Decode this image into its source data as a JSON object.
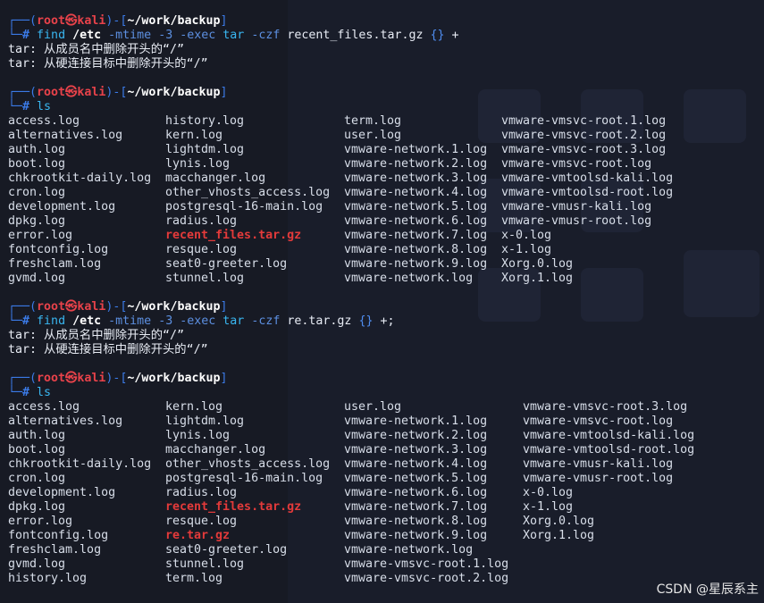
{
  "prompt": {
    "user_host": "root㉿kali",
    "cwd": "~/work/backup",
    "edge_top_left": "┌──(",
    "edge_mid": ")-[",
    "edge_end": "]",
    "edge_bottom": "└─",
    "hash": "#"
  },
  "commands": [
    {
      "tokens": [
        "find",
        "/etc",
        "-mtime",
        "-3",
        "-exec",
        "tar",
        "-czf",
        "recent_files.tar.gz",
        "{}",
        "+"
      ],
      "output": [
        "tar: 从成员名中删除开头的“/”",
        "tar: 从硬连接目标中删除开头的“/”"
      ]
    },
    {
      "tokens": [
        "ls"
      ],
      "columns": [
        [
          "access.log",
          "alternatives.log",
          "auth.log",
          "boot.log",
          "chkrootkit-daily.log",
          "cron.log",
          "development.log",
          "dpkg.log",
          "error.log",
          "fontconfig.log",
          "freshclam.log",
          "gvmd.log"
        ],
        [
          "history.log",
          "kern.log",
          "lightdm.log",
          "lynis.log",
          "macchanger.log",
          "other_vhosts_access.log",
          "postgresql-16-main.log",
          "radius.log",
          "recent_files.tar.gz",
          "resque.log",
          "seat0-greeter.log",
          "stunnel.log"
        ],
        [
          "term.log",
          "user.log",
          "vmware-network.1.log",
          "vmware-network.2.log",
          "vmware-network.3.log",
          "vmware-network.4.log",
          "vmware-network.5.log",
          "vmware-network.6.log",
          "vmware-network.7.log",
          "vmware-network.8.log",
          "vmware-network.9.log",
          "vmware-network.log"
        ],
        [
          "vmware-vmsvc-root.1.log",
          "vmware-vmsvc-root.2.log",
          "vmware-vmsvc-root.3.log",
          "vmware-vmsvc-root.log",
          "vmware-vmtoolsd-kali.log",
          "vmware-vmtoolsd-root.log",
          "vmware-vmusr-kali.log",
          "vmware-vmusr-root.log",
          "x-0.log",
          "x-1.log",
          "Xorg.0.log",
          "Xorg.1.log"
        ]
      ],
      "highlighted": [
        "recent_files.tar.gz"
      ]
    },
    {
      "tokens": [
        "find",
        "/etc",
        "-mtime",
        "-3",
        "-exec",
        "tar",
        "-czf",
        "re.tar.gz",
        "{}",
        "+;"
      ],
      "output": [
        "tar: 从成员名中删除开头的“/”",
        "tar: 从硬连接目标中删除开头的“/”"
      ]
    },
    {
      "tokens": [
        "ls"
      ],
      "columns": [
        [
          "access.log",
          "alternatives.log",
          "auth.log",
          "boot.log",
          "chkrootkit-daily.log",
          "cron.log",
          "development.log",
          "dpkg.log",
          "error.log",
          "fontconfig.log",
          "freshclam.log",
          "gvmd.log",
          "history.log"
        ],
        [
          "kern.log",
          "lightdm.log",
          "lynis.log",
          "macchanger.log",
          "other_vhosts_access.log",
          "postgresql-16-main.log",
          "radius.log",
          "recent_files.tar.gz",
          "resque.log",
          "re.tar.gz",
          "seat0-greeter.log",
          "stunnel.log",
          "term.log"
        ],
        [
          "user.log",
          "vmware-network.1.log",
          "vmware-network.2.log",
          "vmware-network.3.log",
          "vmware-network.4.log",
          "vmware-network.5.log",
          "vmware-network.6.log",
          "vmware-network.7.log",
          "vmware-network.8.log",
          "vmware-network.9.log",
          "vmware-network.log",
          "vmware-vmsvc-root.1.log",
          "vmware-vmsvc-root.2.log"
        ],
        [
          "vmware-vmsvc-root.3.log",
          "vmware-vmsvc-root.log",
          "vmware-vmtoolsd-kali.log",
          "vmware-vmtoolsd-root.log",
          "vmware-vmusr-kali.log",
          "vmware-vmusr-root.log",
          "x-0.log",
          "x-1.log",
          "Xorg.0.log",
          "Xorg.1.log"
        ]
      ],
      "highlighted": [
        "recent_files.tar.gz",
        "re.tar.gz"
      ]
    }
  ],
  "watermark": "CSDN @星辰系主",
  "colors": {
    "background": "#171a24",
    "prompt_edge": "#3b7be8",
    "prompt_user": "#e8424a",
    "command": "#39b6f0",
    "archive_highlight": "#e33a3a",
    "text": "#d8dee9"
  }
}
